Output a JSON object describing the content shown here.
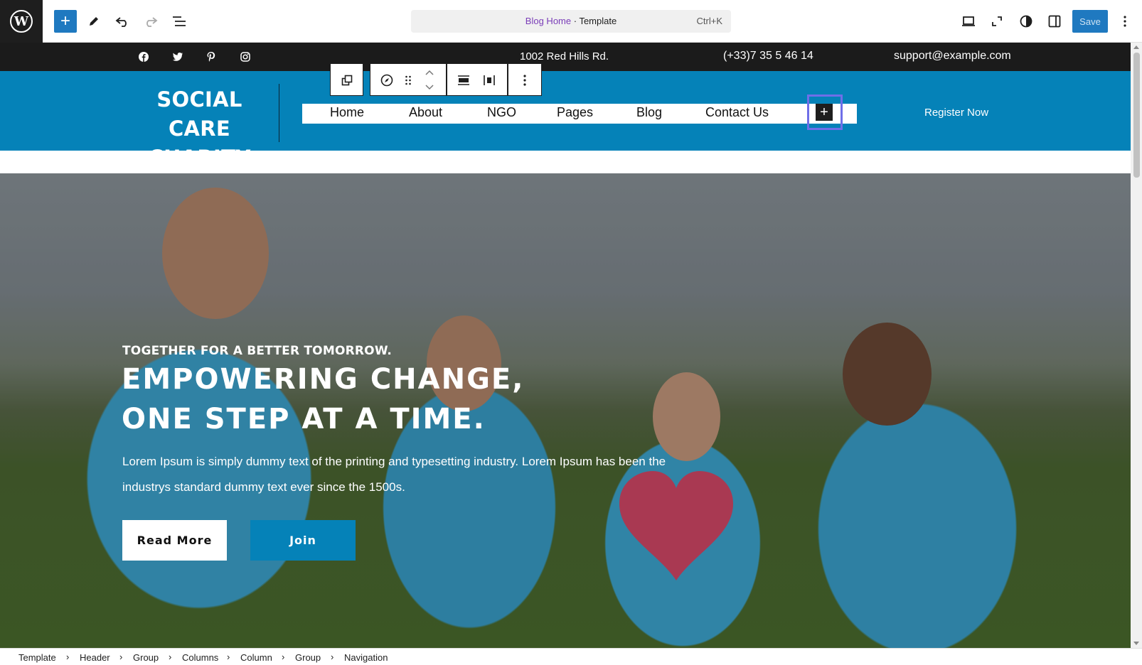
{
  "editor": {
    "command_bar": {
      "link": "Blog Home",
      "separator": " · ",
      "type": "Template",
      "shortcut": "Ctrl+K"
    },
    "save_label": "Save",
    "icons": [
      "wordpress-logo",
      "plus-icon",
      "pencil-icon",
      "undo-icon",
      "redo-icon",
      "list-view-icon",
      "desktop-icon",
      "fullscreen-icon",
      "contrast-icon",
      "sidebar-icon",
      "kebab-icon"
    ]
  },
  "topbar": {
    "address": "1002 Red Hills Rd.",
    "phone": "(+33)7 35 5 46 14",
    "email": "support@example.com",
    "social": [
      "facebook-icon",
      "twitter-icon",
      "pinterest-icon",
      "instagram-icon"
    ]
  },
  "header": {
    "site_title": "SOCIAL CARE CHARITY",
    "nav": [
      "Home",
      "About",
      "NGO",
      "Pages",
      "Blog",
      "Contact Us"
    ],
    "register": "Register Now",
    "add_item": "+"
  },
  "hero": {
    "kicker": "TOGETHER FOR A BETTER TOMORROW.",
    "title_line1": "EMPOWERING CHANGE,",
    "title_line2": "ONE STEP AT A TIME.",
    "description": "Lorem Ipsum is simply dummy text of the printing and typesetting industry. Lorem Ipsum has been the industrys standard dummy text ever since the 1500s.",
    "btn_read_more": "Read More",
    "btn_join": "Join"
  },
  "breadcrumb": [
    "Template",
    "Header",
    "Group",
    "Columns",
    "Column",
    "Group",
    "Navigation"
  ]
}
